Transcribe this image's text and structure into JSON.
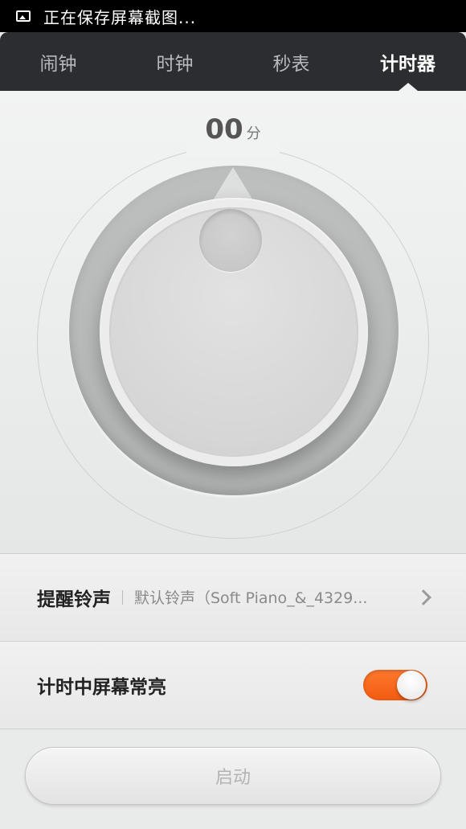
{
  "status_bar": {
    "icon": "image-icon",
    "text": "正在保存屏幕截图..."
  },
  "tabs": [
    {
      "label": "闹钟",
      "active": false
    },
    {
      "label": "时钟",
      "active": false
    },
    {
      "label": "秒表",
      "active": false
    },
    {
      "label": "计时器",
      "active": true
    }
  ],
  "timer": {
    "minutes": "00",
    "unit": "分"
  },
  "settings": {
    "ringtone_label": "提醒铃声",
    "ringtone_value": "默认铃声（Soft Piano_&_4329...",
    "keep_screen_label": "计时中屏幕常亮",
    "keep_screen_on": true
  },
  "actions": {
    "start_label": "启动"
  },
  "colors": {
    "accent": "#f2661c",
    "tab_bar": "#2b2d30"
  }
}
